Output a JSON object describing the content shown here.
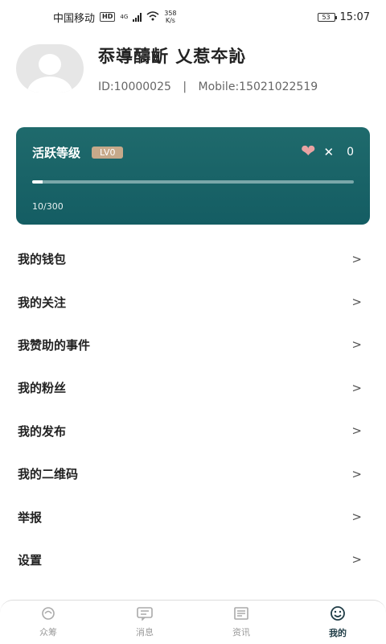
{
  "status_bar": {
    "carrier": "中国移动",
    "hd": "HD",
    "network": "4G",
    "speed": "358",
    "speed_unit": "K/s",
    "battery": "53",
    "time": "15:07"
  },
  "profile": {
    "nickname": "忝導醻齗 乂惹夲訫",
    "id_text": "ID:10000025",
    "separator": "|",
    "mobile_text": "Mobile:15021022519"
  },
  "level": {
    "title": "活跃等级",
    "badge": "LV0",
    "heart_times": "✕",
    "heart_count": "0",
    "progress_text": "10/300",
    "progress_value": 10,
    "progress_max": 300
  },
  "menu": {
    "items": [
      {
        "label": "我的钱包"
      },
      {
        "label": "我的关注"
      },
      {
        "label": "我赞助的事件"
      },
      {
        "label": "我的粉丝"
      },
      {
        "label": "我的发布"
      },
      {
        "label": "我的二维码"
      },
      {
        "label": "举报"
      },
      {
        "label": "设置"
      }
    ],
    "chevron": ">"
  },
  "tabs": {
    "items": [
      {
        "label": "众筹",
        "icon": "crowdfund-icon"
      },
      {
        "label": "消息",
        "icon": "message-icon"
      },
      {
        "label": "资讯",
        "icon": "news-icon"
      },
      {
        "label": "我的",
        "icon": "profile-smile-icon"
      }
    ],
    "active": "我的"
  },
  "colors": {
    "card": "#1f6a6c",
    "badge": "#c6a98a",
    "heart": "#e9a3a3",
    "active_tab": "#1f3c46"
  }
}
